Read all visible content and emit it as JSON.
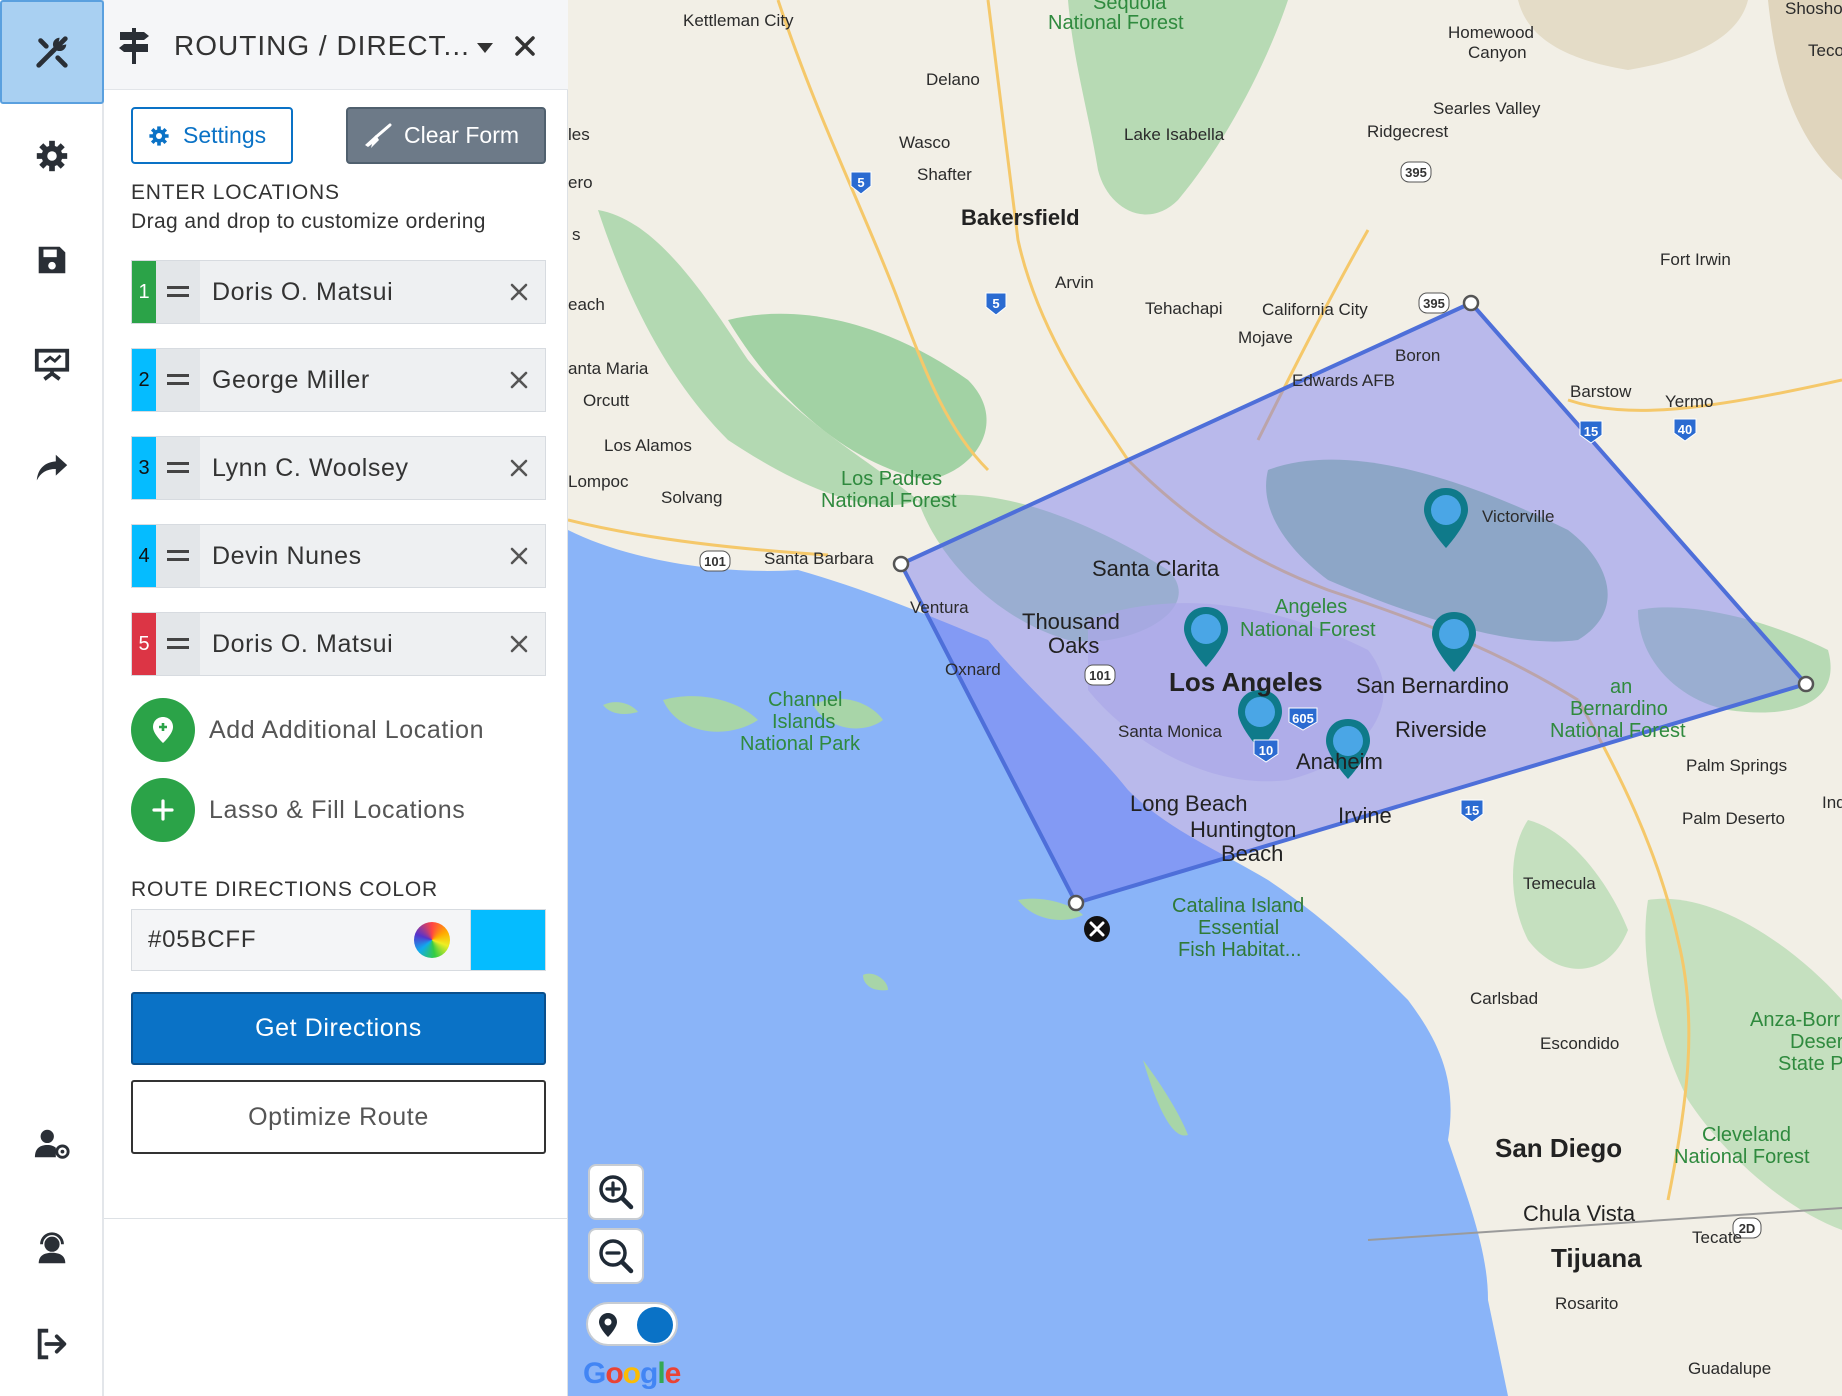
{
  "rail": {
    "items": [
      {
        "name": "tools",
        "icon": "tools-icon",
        "active": true
      },
      {
        "name": "settings",
        "icon": "gear-icon"
      },
      {
        "name": "save",
        "icon": "save-icon"
      },
      {
        "name": "presentation",
        "icon": "presentation-icon"
      },
      {
        "name": "share",
        "icon": "share-icon"
      },
      {
        "name": "user-settings",
        "icon": "user-gear-icon"
      },
      {
        "name": "support",
        "icon": "headset-icon"
      },
      {
        "name": "logout",
        "icon": "logout-icon"
      }
    ]
  },
  "panel": {
    "title": "ROUTING / DIRECT...",
    "settings_label": "Settings",
    "clear_label": "Clear Form",
    "enter_heading": "ENTER LOCATIONS",
    "enter_sub": "Drag and drop to customize ordering",
    "locations": [
      {
        "num": "1",
        "name": "Doris O. Matsui",
        "color": "#2ba348"
      },
      {
        "num": "2",
        "name": "George Miller",
        "color": "#05BCFF"
      },
      {
        "num": "3",
        "name": "Lynn C. Woolsey",
        "color": "#05BCFF"
      },
      {
        "num": "4",
        "name": "Devin Nunes",
        "color": "#05BCFF"
      },
      {
        "num": "5",
        "name": "Doris O. Matsui",
        "color": "#dc3545"
      }
    ],
    "add_location_label": "Add Additional Location",
    "lasso_label": "Lasso & Fill Locations",
    "color_heading": "ROUTE DIRECTIONS COLOR",
    "color_value": "#05BCFF",
    "get_directions_label": "Get Directions",
    "optimize_label": "Optimize Route"
  },
  "map": {
    "labels": {
      "kettleman": "Kettleman City",
      "sequoia": "Sequoia",
      "sequoia_nf": "National Forest",
      "homewood": "Homewood",
      "canyon": "Canyon",
      "shosho": "Shosho",
      "teco": "Teco",
      "delano": "Delano",
      "wasco": "Wasco",
      "shafter": "Shafter",
      "lake_isabella": "Lake Isabella",
      "ridgecrest": "Ridgecrest",
      "searles": "Searles Valley",
      "bakersfield": "Bakersfield",
      "arvin": "Arvin",
      "tehachapi": "Tehachapi",
      "california_city": "California City",
      "mojave": "Mojave",
      "fort_irwin": "Fort Irwin",
      "boron": "Boron",
      "edwards": "Edwards AFB",
      "barstow": "Barstow",
      "yermo": "Yermo",
      "santa_maria": "anta Maria",
      "orcutt": "Orcutt",
      "los_alamos": "Los Alamos",
      "lompoc": "Lompoc",
      "solvang": "Solvang",
      "los_padres": "Los Padres",
      "los_padres_nf": "National Forest",
      "santa_barbara": "Santa Barbara",
      "ventura": "Ventura",
      "oxnard": "Oxnard",
      "victorville": "Victorville",
      "santa_clarita": "Santa Clarita",
      "thousand": "Thousand",
      "oaks": "Oaks",
      "angeles": "Angeles",
      "angeles_nf": "National Forest",
      "los_angeles": "Los Angeles",
      "san_bernardino": "San Bernardino",
      "sb_nf_1": "an",
      "sb_nf_2": "Bernardino",
      "sb_nf_3": "National Forest",
      "santa_monica": "Santa Monica",
      "riverside": "Riverside",
      "anaheim": "Anaheim",
      "channel": "Channel",
      "islands": "Islands",
      "national_park": "National Park",
      "long_beach": "Long Beach",
      "huntington": "Huntington",
      "beach": "Beach",
      "irvine": "Irvine",
      "palm_springs": "Palm Springs",
      "palm_desert": "Palm Deserto",
      "ind": "Ind",
      "temecula": "Temecula",
      "catalina1": "Catalina Island",
      "catalina2": "Essential",
      "catalina3": "Fish Habitat...",
      "carlsbad": "Carlsbad",
      "escondido": "Escondido",
      "anza1": "Anza-Borr",
      "anza2": "Desert",
      "anza3": "State Pa",
      "san_diego": "San Diego",
      "cleveland": "Cleveland",
      "cleveland_nf": "National Forest",
      "chula_vista": "Chula Vista",
      "tecate": "Tecate",
      "tijuana": "Tijuana",
      "rosarito": "Rosarito",
      "guadalupe": "Guadalupe",
      "les": "les",
      "ero": "ero",
      "s": "s",
      "each": "each"
    },
    "shields": {
      "i5a": "5",
      "i5b": "5",
      "r395a": "395",
      "r395b": "395",
      "i15a": "15",
      "i40": "40",
      "r101a": "101",
      "r101b": "101",
      "i605": "605",
      "i10": "10",
      "i15b": "15",
      "r2": "2D"
    },
    "google": "Google",
    "lasso_color": "#7b7ef0",
    "pin_color": "#0f7a8a"
  }
}
